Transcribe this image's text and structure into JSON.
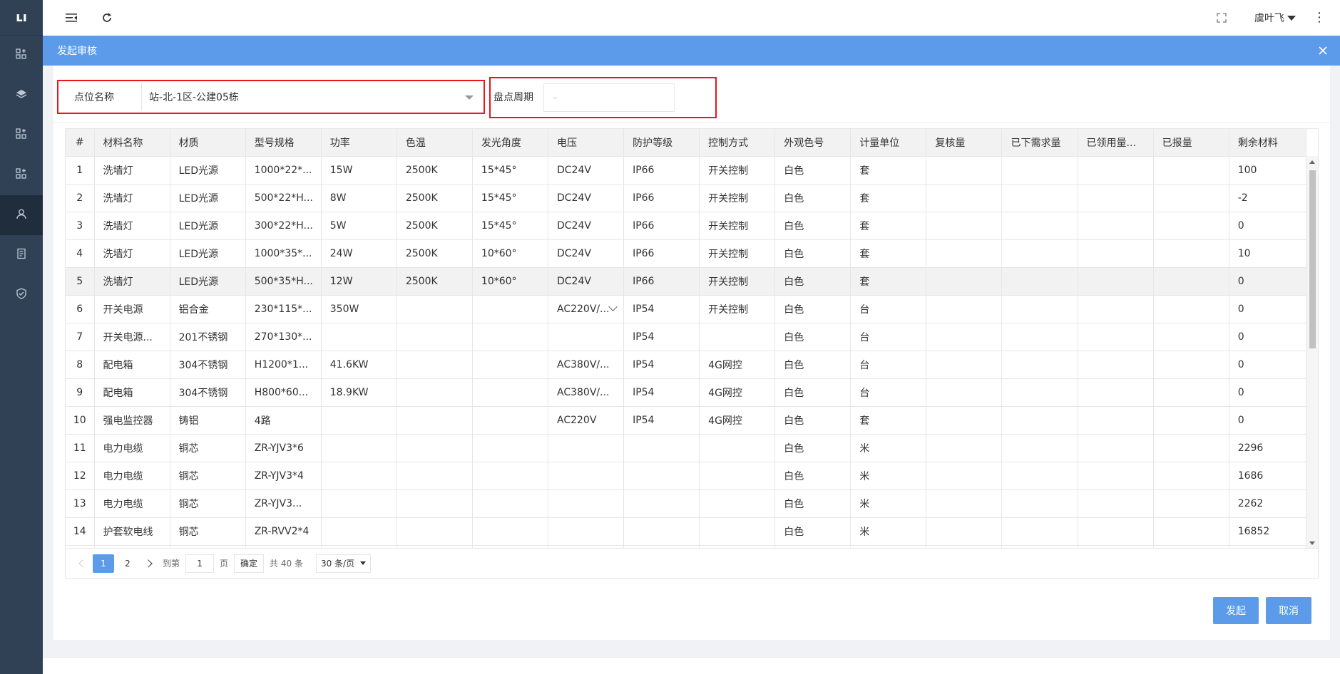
{
  "sidebar": {
    "logo": "ʟı",
    "items": [
      {
        "icon": "grid-plus-icon"
      },
      {
        "icon": "layers-icon"
      },
      {
        "icon": "grid-plus-icon"
      },
      {
        "icon": "grid-plus-icon"
      },
      {
        "icon": "user-icon",
        "active": true
      },
      {
        "icon": "document-icon"
      },
      {
        "icon": "shield-check-icon"
      }
    ]
  },
  "topbar": {
    "user_name": "虞叶飞"
  },
  "dialog": {
    "title": "发起审核",
    "filters": {
      "site_label": "点位名称",
      "site_value": "站-北-1区-公建05栋",
      "period_label": "盘点周期",
      "period_placeholder": "–"
    },
    "table": {
      "columns": [
        "#",
        "材料名称",
        "材质",
        "型号规格",
        "功率",
        "色温",
        "发光角度",
        "电压",
        "防护等级",
        "控制方式",
        "外观色号",
        "计量单位",
        "复核量",
        "已下需求量",
        "已领用量...",
        "已报量",
        "剩余材料"
      ],
      "rows": [
        [
          "1",
          "洗墙灯",
          "LED光源",
          "1000*22*...",
          "15W",
          "2500K",
          "15*45°",
          "DC24V",
          "IP66",
          "开关控制",
          "白色",
          "套",
          "",
          "",
          "",
          "",
          "100"
        ],
        [
          "2",
          "洗墙灯",
          "LED光源",
          "500*22*H...",
          "8W",
          "2500K",
          "15*45°",
          "DC24V",
          "IP66",
          "开关控制",
          "白色",
          "套",
          "",
          "",
          "",
          "",
          "-2"
        ],
        [
          "3",
          "洗墙灯",
          "LED光源",
          "300*22*H...",
          "5W",
          "2500K",
          "15*45°",
          "DC24V",
          "IP66",
          "开关控制",
          "白色",
          "套",
          "",
          "",
          "",
          "",
          "0"
        ],
        [
          "4",
          "洗墙灯",
          "LED光源",
          "1000*35*...",
          "24W",
          "2500K",
          "10*60°",
          "DC24V",
          "IP66",
          "开关控制",
          "白色",
          "套",
          "",
          "",
          "",
          "",
          "10"
        ],
        [
          "5",
          "洗墙灯",
          "LED光源",
          "500*35*H...",
          "12W",
          "2500K",
          "10*60°",
          "DC24V",
          "IP66",
          "开关控制",
          "白色",
          "套",
          "",
          "",
          "",
          "",
          "0"
        ],
        [
          "6",
          "开关电源",
          "铝合金",
          "230*115*...",
          "350W",
          "",
          "",
          "AC220V/...",
          "IP54",
          "开关控制",
          "白色",
          "台",
          "",
          "",
          "",
          "",
          "0"
        ],
        [
          "7",
          "开关电源...",
          "201不锈钢",
          "270*130*...",
          "",
          "",
          "",
          "",
          "IP54",
          "",
          "白色",
          "台",
          "",
          "",
          "",
          "",
          "0"
        ],
        [
          "8",
          "配电箱",
          "304不锈钢",
          "H1200*1...",
          "41.6KW",
          "",
          "",
          "AC380V/...",
          "IP54",
          "4G网控",
          "白色",
          "台",
          "",
          "",
          "",
          "",
          "0"
        ],
        [
          "9",
          "配电箱",
          "304不锈钢",
          "H800*60...",
          "18.9KW",
          "",
          "",
          "AC380V/...",
          "IP54",
          "4G网控",
          "白色",
          "台",
          "",
          "",
          "",
          "",
          "0"
        ],
        [
          "10",
          "强电监控器",
          "铸铝",
          "4路",
          "",
          "",
          "",
          "AC220V",
          "IP54",
          "4G网控",
          "白色",
          "套",
          "",
          "",
          "",
          "",
          "0"
        ],
        [
          "11",
          "电力电缆",
          "铜芯",
          "ZR-YJV3*6",
          "",
          "",
          "",
          "",
          "",
          "",
          "白色",
          "米",
          "",
          "",
          "",
          "",
          "2296"
        ],
        [
          "12",
          "电力电缆",
          "铜芯",
          "ZR-YJV3*4",
          "",
          "",
          "",
          "",
          "",
          "",
          "白色",
          "米",
          "",
          "",
          "",
          "",
          "1686"
        ],
        [
          "13",
          "电力电缆",
          "铜芯",
          "ZR-YJV3...",
          "",
          "",
          "",
          "",
          "",
          "",
          "白色",
          "米",
          "",
          "",
          "",
          "",
          "2262"
        ],
        [
          "14",
          "护套软电线",
          "铜芯",
          "ZR-RVV2*4",
          "",
          "",
          "",
          "",
          "",
          "",
          "白色",
          "米",
          "",
          "",
          "",
          "",
          "16852"
        ],
        [
          "",
          "",
          "",
          "",
          "",
          "",
          "",
          "",
          "",
          "",
          "",
          "",
          "",
          "",
          "",
          "",
          ""
        ]
      ]
    },
    "pagination": {
      "pages": [
        "1",
        "2"
      ],
      "current": "1",
      "goto_label": "到第",
      "goto_value": "1",
      "page_unit": "页",
      "confirm_label": "确定",
      "total_label": "共 40 条",
      "page_size": "30 条/页"
    },
    "buttons": {
      "submit": "发起",
      "cancel": "取消"
    }
  },
  "colors": {
    "accent": "#5b9bea",
    "sidebar": "#304156",
    "highlight_border": "#e8171a"
  }
}
